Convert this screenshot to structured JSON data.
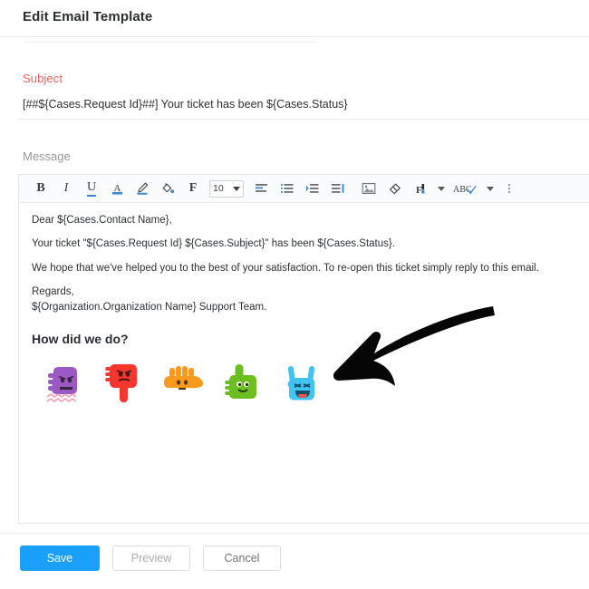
{
  "header": {
    "title": "Edit Email Template"
  },
  "subject": {
    "label": "Subject",
    "value": "[##${Cases.Request Id}##] Your ticket has been ${Cases.Status}"
  },
  "message": {
    "label": "Message"
  },
  "toolbar": {
    "bold": "B",
    "italic": "I",
    "underline": "U",
    "text_color": "A",
    "highlight": "pen-icon",
    "fill_color": "paint-bucket-icon",
    "font_family": "F",
    "font_size_value": "10",
    "align": "align-left-icon",
    "unordered_list": "bullet-list-icon",
    "indent": "indent-icon",
    "outdent": "outdent-icon",
    "image": "image-icon",
    "eraser": "eraser-icon",
    "format_paint": "format-paint-icon",
    "format_caret": "chevron-down-icon",
    "spellcheck": "ABC",
    "spellcheck_caret": "chevron-down-icon",
    "overflow": "kebab-menu-icon"
  },
  "body": {
    "greeting": "Dear ${Cases.Contact Name},",
    "line_ticket": "Your ticket \"${Cases.Request Id} ${Cases.Subject}\" has been ${Cases.Status}.",
    "line_hope": "We hope that we've helped you to the best of your satisfaction. To re-open this ticket simply reply to this email.",
    "regards": "Regards,",
    "signature": "${Organization.Organization Name} Support Team.",
    "rating_heading": "How did we do?",
    "ratings": [
      {
        "name": "rating-fist-purple",
        "color": "#9b59c4",
        "label": "angry-fist"
      },
      {
        "name": "rating-thumbs-down-red",
        "color": "#f5372e",
        "label": "thumbs-down"
      },
      {
        "name": "rating-flat-hand-orange",
        "color": "#f79a1e",
        "label": "neutral-hand"
      },
      {
        "name": "rating-thumbs-up-green",
        "color": "#6dbe20",
        "label": "thumbs-up"
      },
      {
        "name": "rating-rock-on-blue",
        "color": "#43c3f0",
        "label": "rock-on"
      }
    ]
  },
  "annotation": {
    "arrow": "curved-arrow-pointing-down-left",
    "color": "#000000"
  },
  "footer": {
    "save": "Save",
    "preview": "Preview",
    "cancel": "Cancel"
  },
  "colors": {
    "accent": "#18a0fb",
    "subject_label": "#f4655a",
    "text": "#2d3135"
  }
}
